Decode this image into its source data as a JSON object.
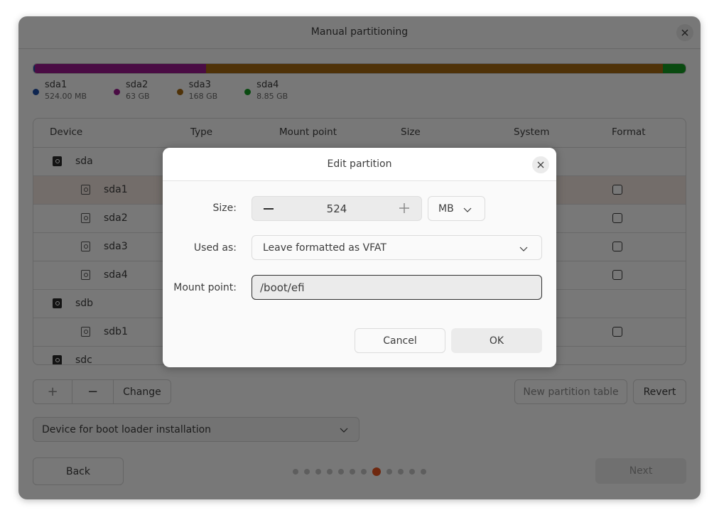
{
  "window": {
    "title": "Manual partitioning",
    "close_icon": "close-icon"
  },
  "usage_bar": {
    "segments": [
      {
        "name": "sda1",
        "color": "#1f4fa8",
        "fraction": 0.002
      },
      {
        "name": "sda2",
        "color": "#9b1a8f",
        "fraction": 0.263
      },
      {
        "name": "sda3",
        "color": "#a56a12",
        "fraction": 0.7
      },
      {
        "name": "sda4",
        "color": "#139b22",
        "fraction": 0.035
      }
    ]
  },
  "legend": [
    {
      "name": "sda1",
      "size": "524.00 MB",
      "color": "#1f4fa8"
    },
    {
      "name": "sda2",
      "size": "63 GB",
      "color": "#9b1a8f"
    },
    {
      "name": "sda3",
      "size": "168 GB",
      "color": "#a56a12"
    },
    {
      "name": "sda4",
      "size": "8.85 GB",
      "color": "#139b22"
    }
  ],
  "table": {
    "columns": [
      "Device",
      "Type",
      "Mount point",
      "Size",
      "System",
      "Format"
    ],
    "rows": [
      {
        "device": "sda",
        "kind": "disk",
        "format_checkbox": false,
        "selected": false
      },
      {
        "device": "sda1",
        "kind": "partition",
        "format_checkbox": true,
        "format_checked": false,
        "selected": true
      },
      {
        "device": "sda2",
        "kind": "partition",
        "format_checkbox": true,
        "format_checked": false,
        "selected": false
      },
      {
        "device": "sda3",
        "kind": "partition",
        "format_checkbox": true,
        "format_checked": false,
        "selected": false
      },
      {
        "device": "sda4",
        "kind": "partition",
        "format_checkbox": true,
        "format_checked": false,
        "selected": false
      },
      {
        "device": "sdb",
        "kind": "disk",
        "format_checkbox": false,
        "selected": false
      },
      {
        "device": "sdb1",
        "kind": "partition",
        "format_checkbox": true,
        "format_checked": false,
        "selected": false
      },
      {
        "device": "sdc",
        "kind": "disk",
        "format_checkbox": false,
        "selected": false
      }
    ]
  },
  "toolbar": {
    "add_label": "+",
    "remove_label": "−",
    "change_label": "Change",
    "new_table_label": "New partition table",
    "revert_label": "Revert"
  },
  "bootloader": {
    "label": "Device for boot loader installation"
  },
  "nav": {
    "back_label": "Back",
    "next_label": "Next",
    "steps_total": 12,
    "current_step": 8,
    "active_color": "#e95420"
  },
  "dialog": {
    "title": "Edit partition",
    "size_label": "Size:",
    "size_value": "524",
    "size_unit": "MB",
    "used_as_label": "Used as:",
    "used_as_value": "Leave formatted as VFAT",
    "mount_label": "Mount point:",
    "mount_value": "/boot/efi",
    "cancel_label": "Cancel",
    "ok_label": "OK"
  }
}
